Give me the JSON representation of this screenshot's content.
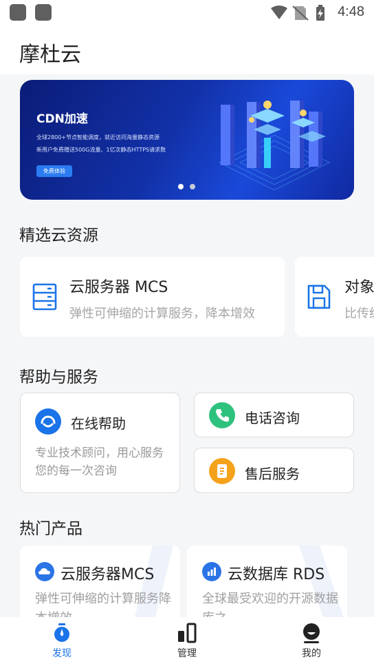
{
  "status_bar": {
    "time": "4:48"
  },
  "app": {
    "title": "摩杜云"
  },
  "banner": {
    "title": "CDN加速",
    "line1": "全球2800+节点智能调度，就近访问海量静态资源",
    "line2": "新用户免费赠送500G流量、1亿次静态HTTPS请求数",
    "button": "免费体验",
    "active_slide": 1,
    "slide_count": 2
  },
  "featured": {
    "heading": "精选云资源",
    "items": [
      {
        "title": "云服务器 MCS",
        "desc": "弹性可伸缩的计算服务，降本增效",
        "icon": "server-icon"
      },
      {
        "title": "对象",
        "desc": "比传统",
        "icon": "save-icon"
      }
    ]
  },
  "help": {
    "heading": "帮助与服务",
    "online": {
      "title": "在线帮助",
      "desc": "专业技术顾问，用心服务您的每一次咨询",
      "icon": "headset-icon"
    },
    "phone": {
      "title": "电话咨询",
      "icon": "phone-icon"
    },
    "after_sales": {
      "title": "售后服务",
      "icon": "clipboard-icon"
    }
  },
  "hot": {
    "heading": "热门产品",
    "items": [
      {
        "title": "云服务器MCS",
        "desc": "弹性可伸缩的计算服务降本增效",
        "icon": "cloud-icon"
      },
      {
        "title": "云数据库 RDS",
        "desc": "全球最受欢迎的开源数据库之",
        "icon": "chart-icon"
      }
    ]
  },
  "tabs": [
    {
      "label": "发现",
      "icon": "discover-icon",
      "active": true
    },
    {
      "label": "管理",
      "icon": "manage-icon",
      "active": false
    },
    {
      "label": "我的",
      "icon": "profile-icon",
      "active": false
    }
  ],
  "colors": {
    "accent": "#1a73e8",
    "green": "#2ec27e",
    "orange": "#f5a21b",
    "tab_inactive": "#333333"
  }
}
